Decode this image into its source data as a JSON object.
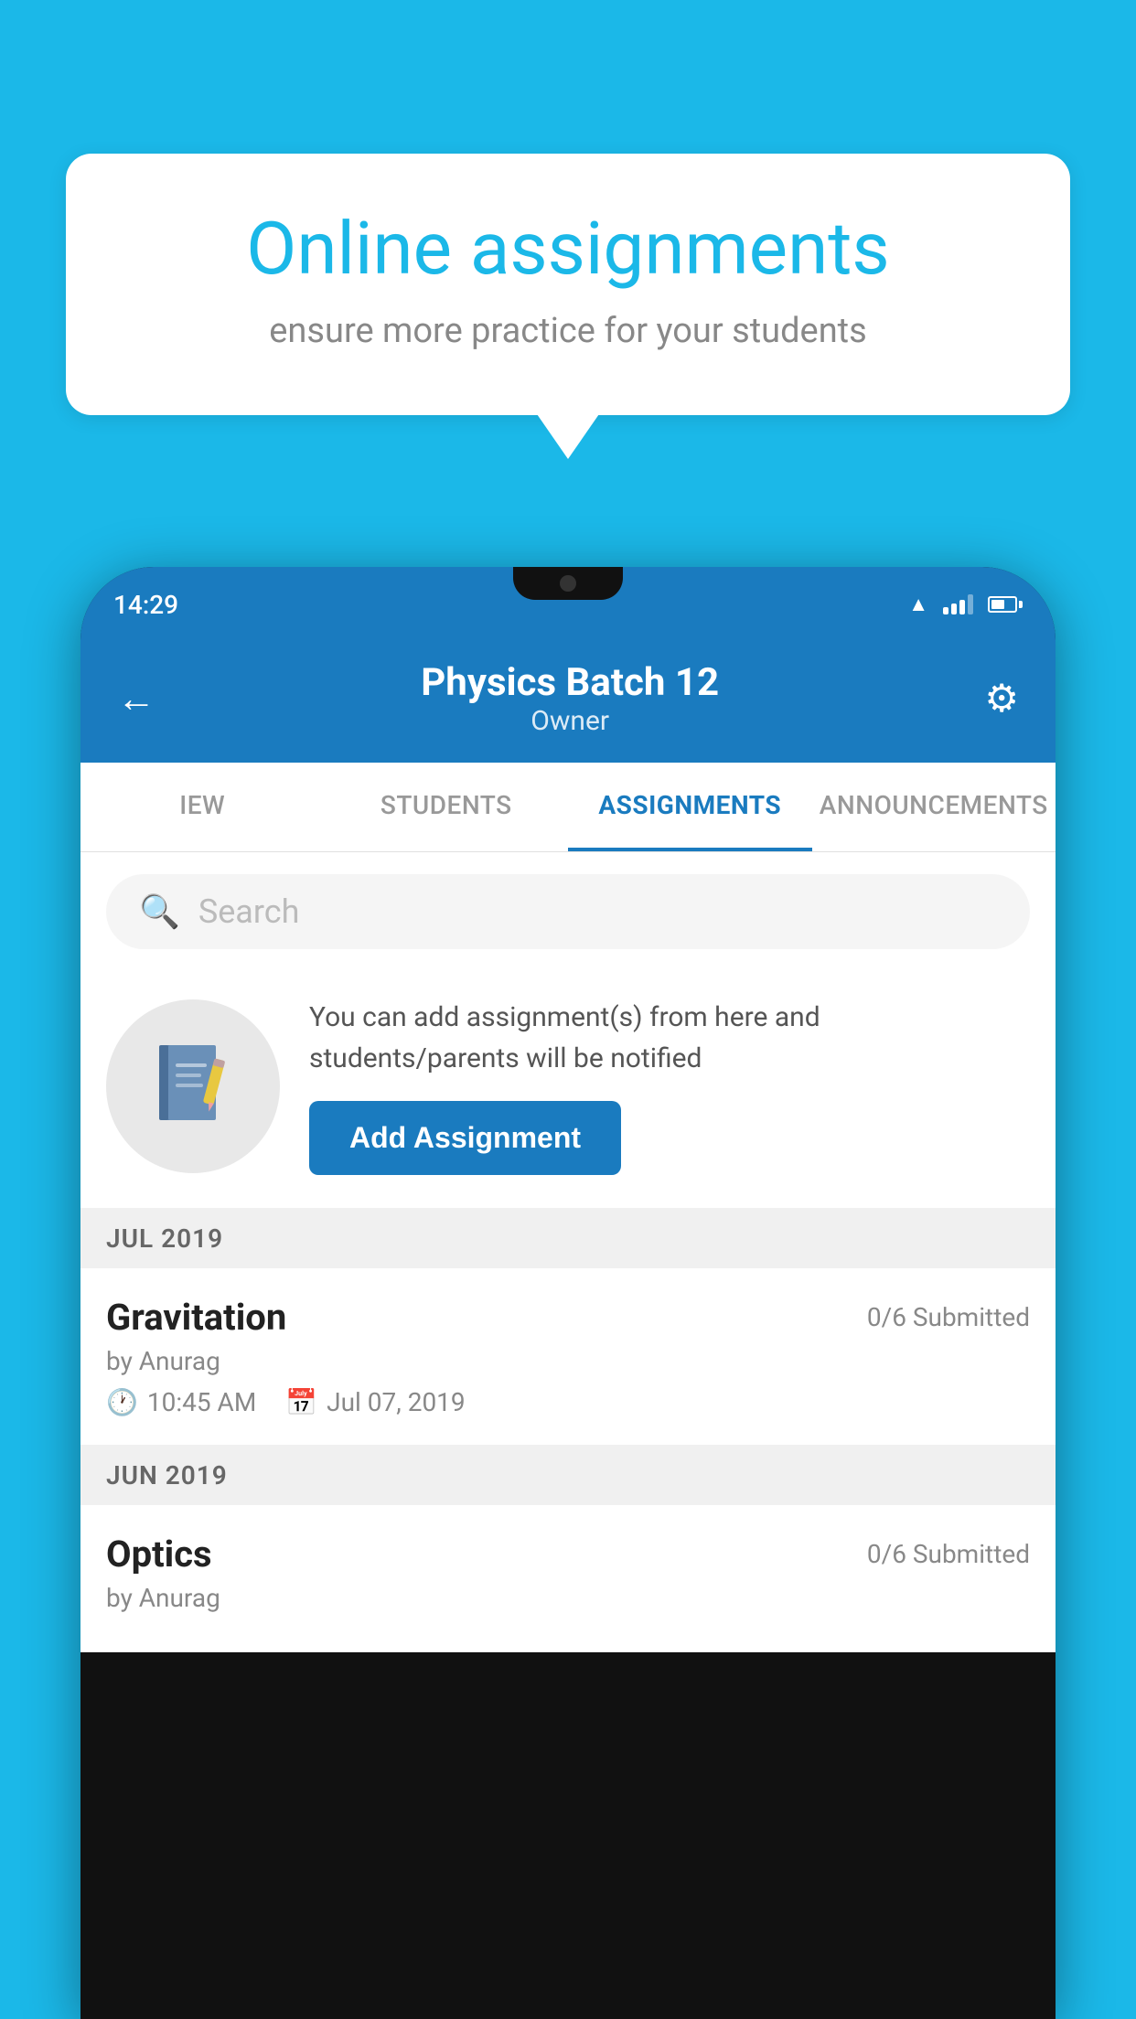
{
  "background_color": "#1bb8e8",
  "speech_bubble": {
    "title": "Online assignments",
    "subtitle": "ensure more practice for your students"
  },
  "phone": {
    "status_bar": {
      "time": "14:29"
    },
    "header": {
      "title": "Physics Batch 12",
      "subtitle": "Owner",
      "back_label": "←",
      "settings_label": "⚙"
    },
    "tabs": [
      {
        "id": "iew",
        "label": "IEW",
        "active": false
      },
      {
        "id": "students",
        "label": "STUDENTS",
        "active": false
      },
      {
        "id": "assignments",
        "label": "ASSIGNMENTS",
        "active": true
      },
      {
        "id": "announcements",
        "label": "ANNOUNCEMENTS",
        "active": false
      }
    ],
    "search": {
      "placeholder": "Search"
    },
    "promo": {
      "text": "You can add assignment(s) from here and students/parents will be notified",
      "button_label": "Add Assignment"
    },
    "sections": [
      {
        "id": "jul2019",
        "label": "JUL 2019",
        "assignments": [
          {
            "id": "gravitation",
            "name": "Gravitation",
            "submitted": "0/6 Submitted",
            "by": "by Anurag",
            "time": "10:45 AM",
            "date": "Jul 07, 2019"
          }
        ]
      },
      {
        "id": "jun2019",
        "label": "JUN 2019",
        "assignments": [
          {
            "id": "optics",
            "name": "Optics",
            "submitted": "0/6 Submitted",
            "by": "by Anurag",
            "time": "",
            "date": ""
          }
        ]
      }
    ]
  }
}
